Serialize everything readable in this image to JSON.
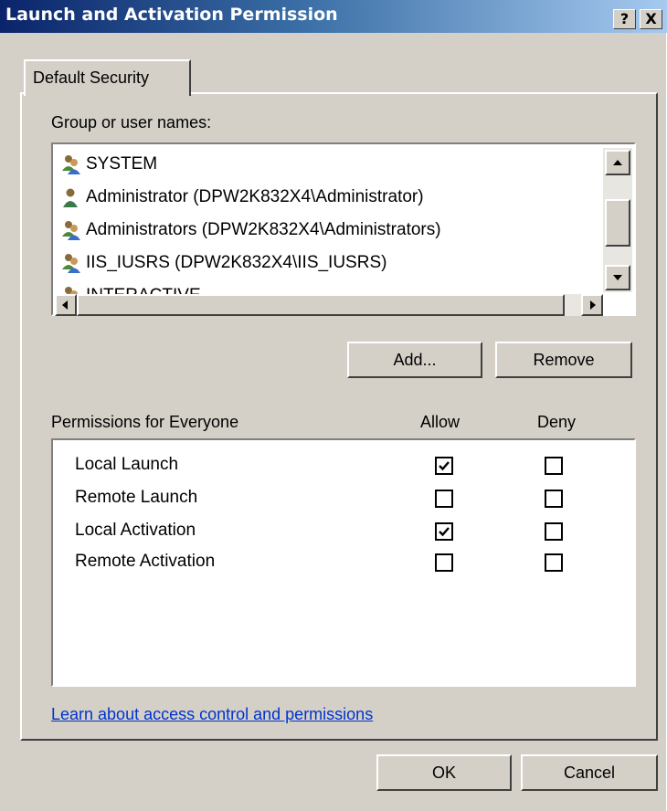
{
  "window": {
    "title": "Launch and Activation Permission",
    "help_button": "?",
    "close_button": "X"
  },
  "tab": {
    "label": "Default Security"
  },
  "users": {
    "label": "Group or user names:",
    "items": [
      {
        "name": "SYSTEM",
        "icon": "group-icon"
      },
      {
        "name": "Administrator (DPW2K832X4\\Administrator)",
        "icon": "user-icon"
      },
      {
        "name": "Administrators (DPW2K832X4\\Administrators)",
        "icon": "group-icon"
      },
      {
        "name": "IIS_IUSRS (DPW2K832X4\\IIS_IUSRS)",
        "icon": "group-icon"
      },
      {
        "name": "INTERACTIVE",
        "icon": "group-icon"
      }
    ]
  },
  "buttons": {
    "add": "Add...",
    "remove": "Remove",
    "ok": "OK",
    "cancel": "Cancel"
  },
  "permissions": {
    "label": "Permissions for Everyone",
    "allow_header": "Allow",
    "deny_header": "Deny",
    "rows": [
      {
        "name": "Local Launch",
        "allow": true,
        "deny": false
      },
      {
        "name": "Remote Launch",
        "allow": false,
        "deny": false
      },
      {
        "name": "Local Activation",
        "allow": true,
        "deny": false
      },
      {
        "name": "Remote Activation",
        "allow": false,
        "deny": false
      }
    ]
  },
  "link": {
    "text": "Learn about access control and permissions"
  }
}
